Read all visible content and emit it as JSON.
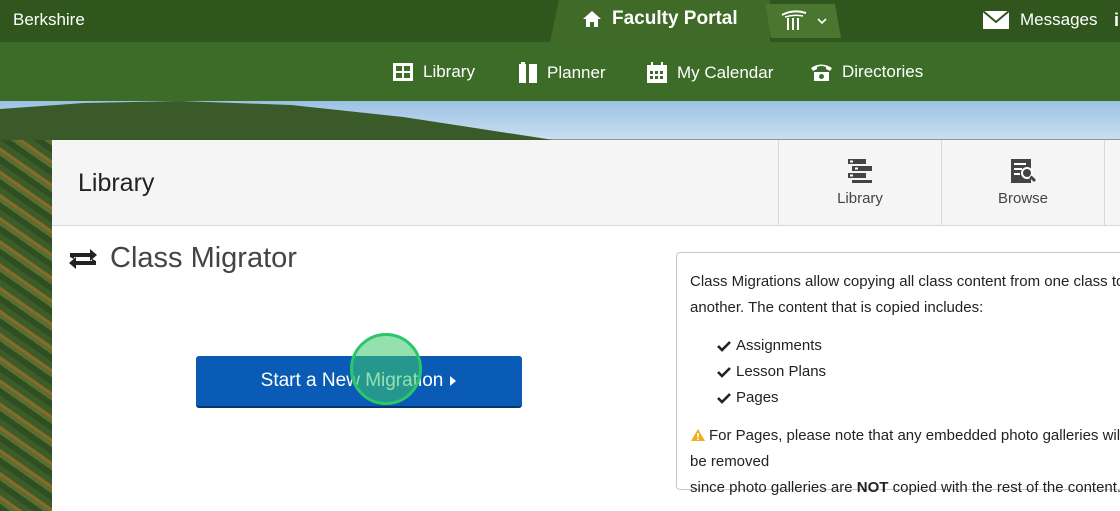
{
  "topbar": {
    "brand": "Berkshire",
    "portal_label": "Faculty Portal",
    "messages_label": "Messages",
    "edge_glyph": "i"
  },
  "subnav": {
    "items": [
      {
        "label": "Library",
        "icon": "grid-icon"
      },
      {
        "label": "Planner",
        "icon": "planner-icon"
      },
      {
        "label": "My Calendar",
        "icon": "calendar-icon"
      },
      {
        "label": "Directories",
        "icon": "phone-icon"
      }
    ]
  },
  "panel": {
    "title": "Library",
    "tiles": [
      {
        "label": "Library",
        "icon": "shelves-icon"
      },
      {
        "label": "Browse",
        "icon": "browse-icon"
      }
    ]
  },
  "section": {
    "title": "Class Migrator",
    "start_button": "Start a New Migration"
  },
  "info": {
    "intro": "Class Migrations allow copying all class content from one class to another. The content that is copied includes:",
    "items": [
      "Assignments",
      "Lesson Plans",
      "Pages"
    ],
    "note_before": "For Pages, please note that any embedded photo galleries will be removed",
    "note_line2_start": "since photo galleries are",
    "note_bold": "NOT",
    "note_end": "copied with the rest of the content."
  },
  "colors": {
    "topbar": "#31561d",
    "subnav": "#3c6c27",
    "primary_button": "#0a5bb5",
    "warning": "#f0ad1e"
  }
}
